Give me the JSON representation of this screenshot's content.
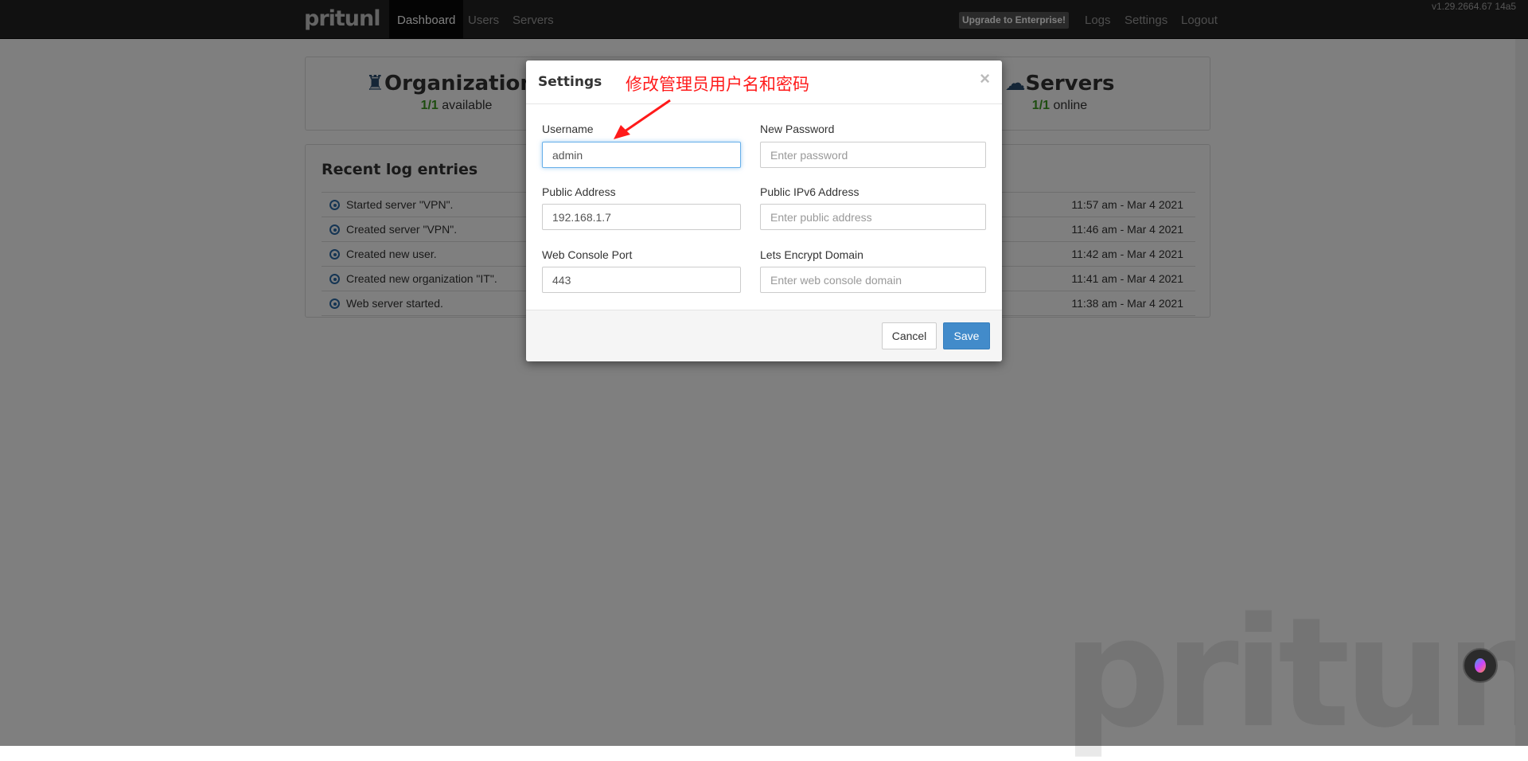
{
  "nav": {
    "logo": "pritunl",
    "items": [
      {
        "label": "Dashboard",
        "active": true
      },
      {
        "label": "Users"
      },
      {
        "label": "Servers"
      }
    ],
    "upgrade": "Upgrade to Enterprise!",
    "right": [
      "Logs",
      "Settings",
      "Logout"
    ],
    "version": "v1.29.2664.67 14a5"
  },
  "stats": {
    "organizations": {
      "title": "Organizations",
      "count": "1/1",
      "suffix": " available"
    },
    "servers": {
      "title": "Servers",
      "count": "1/1",
      "suffix": " online"
    }
  },
  "logs": {
    "title": "Recent log entries",
    "entries": [
      {
        "message": "Started server \"VPN\".",
        "time": "11:57 am - Mar 4 2021"
      },
      {
        "message": "Created server \"VPN\".",
        "time": "11:46 am - Mar 4 2021"
      },
      {
        "message": "Created new user.",
        "time": "11:42 am - Mar 4 2021"
      },
      {
        "message": "Created new organization \"IT\".",
        "time": "11:41 am - Mar 4 2021"
      },
      {
        "message": "Web server started.",
        "time": "11:38 am - Mar 4 2021"
      }
    ]
  },
  "watermark": "pritunl",
  "modal": {
    "title": "Settings",
    "annotation": "修改管理员用户名和密码",
    "close": "×",
    "fields": {
      "username": {
        "label": "Username",
        "value": "admin"
      },
      "new_password": {
        "label": "New Password",
        "placeholder": "Enter password"
      },
      "public_address": {
        "label": "Public Address",
        "value": "192.168.1.7"
      },
      "public_ipv6": {
        "label": "Public IPv6 Address",
        "placeholder": "Enter public address"
      },
      "port": {
        "label": "Web Console Port",
        "value": "443"
      },
      "domain": {
        "label": "Lets Encrypt Domain",
        "placeholder": "Enter web console domain"
      }
    },
    "cancel": "Cancel",
    "save": "Save"
  },
  "colors": {
    "accent": "#428bca",
    "annotation": "#ff1a1a",
    "count": "#3c9a20"
  }
}
